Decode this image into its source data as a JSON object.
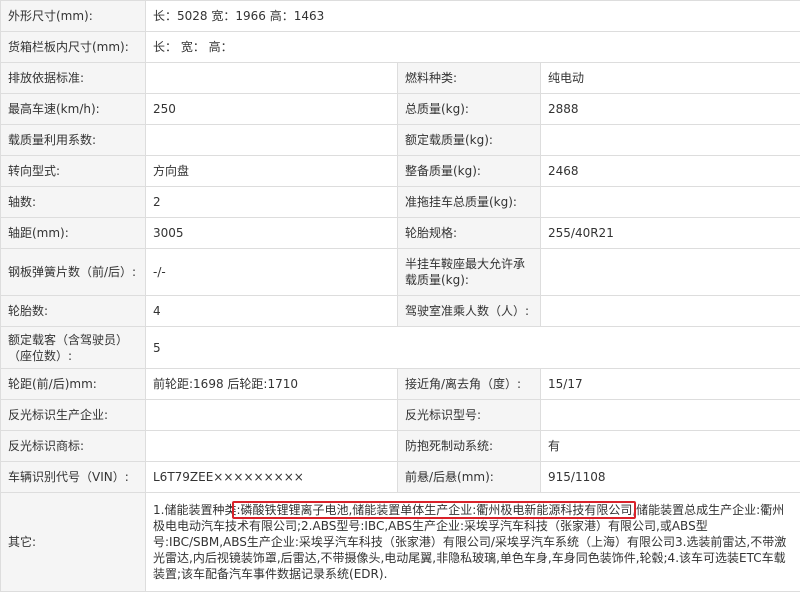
{
  "spec": {
    "dimensions_label": "外形尺寸(mm):",
    "dimensions_value": "长：5028 宽：1966 高：1463",
    "cargo_box_label": "货箱栏板内尺寸(mm):",
    "cargo_box_value": "长： 宽： 高：",
    "emission_standard_label": "排放依据标准:",
    "emission_standard_value": "",
    "fuel_type_label": "燃料种类:",
    "fuel_type_value": "纯电动",
    "max_speed_label": "最高车速(km/h):",
    "max_speed_value": "250",
    "total_mass_label": "总质量(kg):",
    "total_mass_value": "2888",
    "load_util_label": "载质量利用系数:",
    "load_util_value": "",
    "rated_load_label": "额定载质量(kg):",
    "rated_load_value": "",
    "steering_label": "转向型式:",
    "steering_value": "方向盘",
    "curb_mass_label": "整备质量(kg):",
    "curb_mass_value": "2468",
    "axles_label": "轴数:",
    "axles_value": "2",
    "trailer_mass_label": "准拖挂车总质量(kg):",
    "trailer_mass_value": "",
    "wheelbase_label": "轴距(mm):",
    "wheelbase_value": "3005",
    "tire_spec_label": "轮胎规格:",
    "tire_spec_value": "255/40R21",
    "leaf_spring_label": "钢板弹簧片数（前/后）:",
    "leaf_spring_value": "-/-",
    "saddle_load_label": "半挂车鞍座最大允许承载质量(kg):",
    "saddle_load_value": "",
    "tire_count_label": "轮胎数:",
    "tire_count_value": "4",
    "cab_seats_label": "驾驶室准乘人数（人）:",
    "cab_seats_value": "",
    "rated_passengers_label": "额定载客（含驾驶员）（座位数）:",
    "rated_passengers_value": "5",
    "track_label": "轮距(前/后)mm:",
    "track_value": "前轮距:1698 后轮距:1710",
    "approach_label": "接近角/离去角（度）:",
    "approach_value": "15/17",
    "reflector_maker_label": "反光标识生产企业:",
    "reflector_maker_value": "",
    "reflector_model_label": "反光标识型号:",
    "reflector_model_value": "",
    "reflector_brand_label": "反光标识商标:",
    "reflector_brand_value": "",
    "abs_label": "防抱死制动系统:",
    "abs_value": "有",
    "vin_label": "车辆识别代号（VIN）:",
    "vin_value": "L6T79ZEE×××××××××",
    "overhang_label": "前悬/后悬(mm):",
    "overhang_value": "915/1108",
    "other_label": "其它:",
    "other_prefix": "1.储能装置种类",
    "other_highlight": ":磷酸铁锂锂离子电池,储能装置单体生产企业:衢州极电新能源科技有限公司",
    "other_suffix": ",储能装置总成生产企业:衢州极电电动汽车技术有限公司;2.ABS型号:IBC,ABS生产企业:采埃孚汽车科技（张家港）有限公司,或ABS型号:IBC/SBM,ABS生产企业:采埃孚汽车科技（张家港）有限公司/采埃孚汽车系统（上海）有限公司3.选装前雷达,不带激光雷达,内后视镜装饰罩,后雷达,不带摄像头,电动尾翼,非隐私玻璃,单色车身,车身同色装饰件,轮毂;4.该车可选装ETC车载装置;该车配备汽车事件数据记录系统(EDR)."
  },
  "colors": {
    "label_bg": "#f5f5f5",
    "border": "#dddddd",
    "text": "#333333",
    "highlight_box": "#d9222a"
  }
}
